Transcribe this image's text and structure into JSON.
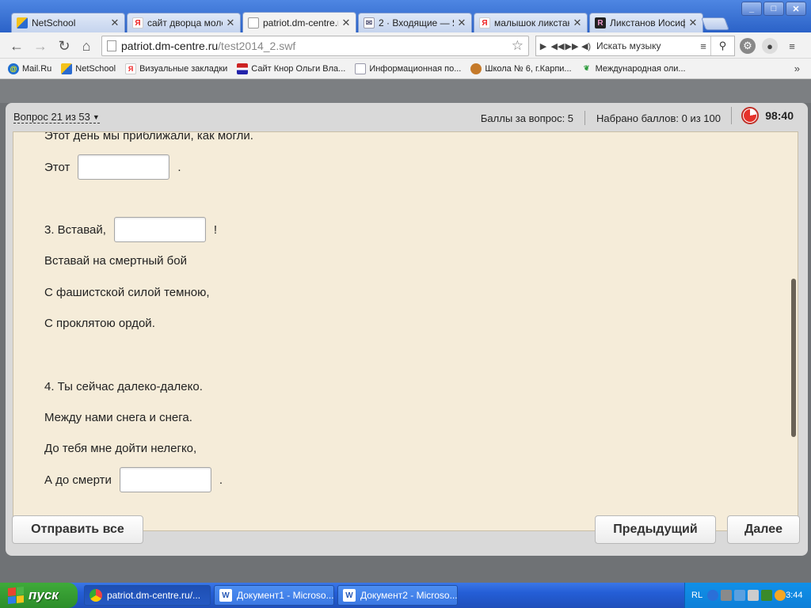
{
  "browser": {
    "tabs": [
      {
        "title": "NetSchool",
        "icon": "netschool-icon",
        "active": false
      },
      {
        "title": "сайт дворца моло",
        "icon": "yandex-icon",
        "active": false
      },
      {
        "title": "patriot.dm-centre.r",
        "icon": "page-icon",
        "active": true
      },
      {
        "title": "2 · Входящие — Я",
        "icon": "mail-icon",
        "active": false
      },
      {
        "title": "малышок ликстан",
        "icon": "yandex-icon",
        "active": false
      },
      {
        "title": "Ликстанов Иосиф",
        "icon": "fr-icon",
        "active": false
      }
    ],
    "address": {
      "host": "patriot.dm-centre.ru",
      "path": "/test2014_2.swf"
    },
    "music_search": "Искать музыку",
    "bookmarks": [
      {
        "label": "Mail.Ru"
      },
      {
        "label": "NetSchool"
      },
      {
        "label": "Визуальные закладки"
      },
      {
        "label": "Сайт Кнор Ольги Вла..."
      },
      {
        "label": "Информационная по..."
      },
      {
        "label": "Школа № 6, г.Карпи..."
      },
      {
        "label": "Международная оли..."
      }
    ],
    "more": "»"
  },
  "test": {
    "question_label": "Вопрос 21 из 53",
    "points_per_question": "Баллы за вопрос: 5",
    "total_points": "Набрано баллов: 0 из 100",
    "timer": "98:40",
    "lines": {
      "l1": "Этот день мы приближали, как могли.",
      "l2a": "Этот",
      "l2b": ".",
      "l3a": "3. Вставай,",
      "l3b": "!",
      "l4": "Вставай на смертный бой",
      "l5": "С фашистской силой темною,",
      "l6": "С проклятою ордой.",
      "l7": "4. Ты сейчас далеко-далеко.",
      "l8": "Между нами снега и снега.",
      "l9": "До тебя мне дойти нелегко,",
      "l10a": "А до смерти",
      "l10b": "."
    },
    "buttons": {
      "submit_all": "Отправить все",
      "previous": "Предыдущий",
      "next": "Далее"
    }
  },
  "taskbar": {
    "start": "пуск",
    "tasks": [
      {
        "label": "patriot.dm-centre.ru/..."
      },
      {
        "label": "Документ1 - Microso..."
      },
      {
        "label": "Документ2 - Microso..."
      }
    ],
    "lang": "RL",
    "time": "3:44"
  }
}
